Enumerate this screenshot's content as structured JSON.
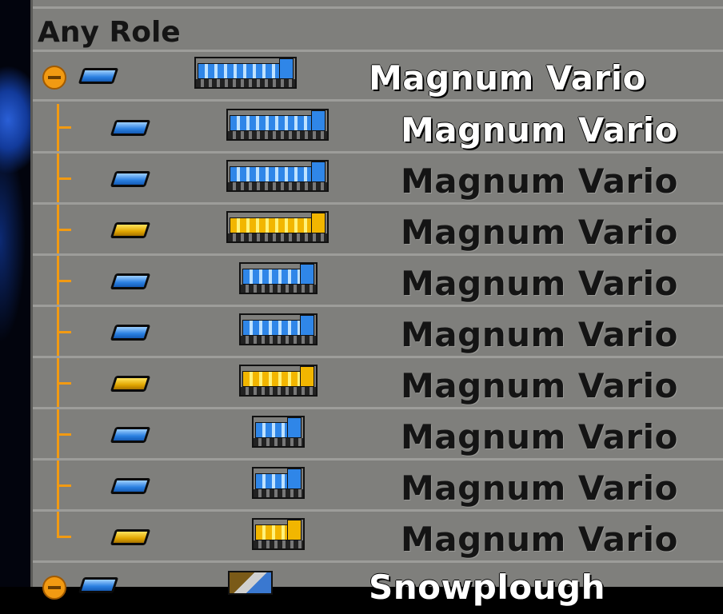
{
  "header": {
    "label": "Any Role"
  },
  "group": {
    "name": "Magnum Vario",
    "role_color": "blue",
    "loco_color": "blue",
    "expanded": true,
    "icon": "collapse-minus-icon"
  },
  "variants": [
    {
      "name": "Magnum Vario",
      "role_color": "blue",
      "loco_color": "blue",
      "selected": true
    },
    {
      "name": "Magnum Vario",
      "role_color": "blue",
      "loco_color": "blue",
      "selected": false
    },
    {
      "name": "Magnum Vario",
      "role_color": "gold",
      "loco_color": "gold",
      "selected": false
    },
    {
      "name": "Magnum Vario",
      "role_color": "blue",
      "loco_color": "blue",
      "selected": false
    },
    {
      "name": "Magnum Vario",
      "role_color": "blue",
      "loco_color": "blue",
      "selected": false
    },
    {
      "name": "Magnum Vario",
      "role_color": "gold",
      "loco_color": "gold",
      "selected": false
    },
    {
      "name": "Magnum Vario",
      "role_color": "blue",
      "loco_color": "blue",
      "selected": false
    },
    {
      "name": "Magnum Vario",
      "role_color": "blue",
      "loco_color": "blue",
      "selected": false
    },
    {
      "name": "Magnum Vario",
      "role_color": "gold",
      "loco_color": "gold",
      "selected": false
    }
  ],
  "next_group": {
    "name": "Snowplough",
    "icon": "expand-plus-icon"
  },
  "colors": {
    "panel": "#7f7f7c",
    "separator": "#9d9d9a",
    "tree": "#f29a12",
    "blue": "#2f86e8",
    "gold": "#f2b600"
  }
}
